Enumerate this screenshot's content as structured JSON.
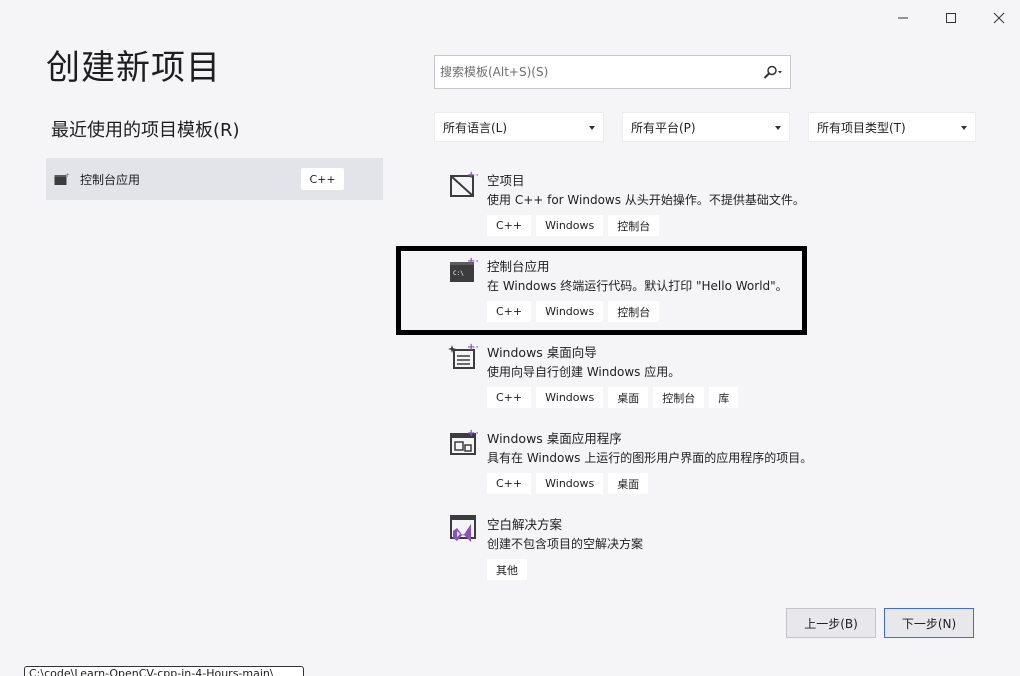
{
  "window": {
    "minimize_icon": "minimize-icon",
    "maximize_icon": "maximize-icon",
    "close_icon": "close-icon"
  },
  "header": {
    "title": "创建新项目",
    "recent_title": "最近使用的项目模板(R)"
  },
  "recent": {
    "items": [
      {
        "label": "控制台应用",
        "badge": "C++",
        "icon": "console-app-icon"
      }
    ]
  },
  "search": {
    "placeholder": "搜索模板(Alt+S)(S)",
    "icon": "search-icon"
  },
  "filters": {
    "language": "所有语言(L)",
    "platform": "所有平台(P)",
    "project_type": "所有项目类型(T)"
  },
  "templates": [
    {
      "name": "空项目",
      "description": "使用 C++ for Windows 从头开始操作。不提供基础文件。",
      "tags": [
        "C++",
        "Windows",
        "控制台"
      ],
      "icon": "empty-project-icon"
    },
    {
      "name": "控制台应用",
      "description": "在 Windows 终端运行代码。默认打印 \"Hello World\"。",
      "tags": [
        "C++",
        "Windows",
        "控制台"
      ],
      "icon": "console-app-icon"
    },
    {
      "name": "Windows 桌面向导",
      "description": "使用向导自行创建 Windows 应用。",
      "tags": [
        "C++",
        "Windows",
        "桌面",
        "控制台",
        "库"
      ],
      "icon": "desktop-wizard-icon"
    },
    {
      "name": "Windows 桌面应用程序",
      "description": "具有在 Windows 上运行的图形用户界面的应用程序的项目。",
      "tags": [
        "C++",
        "Windows",
        "桌面"
      ],
      "icon": "desktop-app-icon"
    },
    {
      "name": "空白解决方案",
      "description": "创建不包含项目的空解决方案",
      "tags": [
        "其他"
      ],
      "icon": "blank-solution-icon"
    }
  ],
  "footer": {
    "back_label": "上一步(B)",
    "next_label": "下一步(N)",
    "status_path": "C:\\code\\Learn-OpenCV-cpp-in-4-Hours-main\\"
  },
  "colors": {
    "background": "#f5f5f7",
    "selected": "#e2e4ea",
    "accent_purple": "#8a50c8",
    "primary_border": "#3c6fd1"
  }
}
